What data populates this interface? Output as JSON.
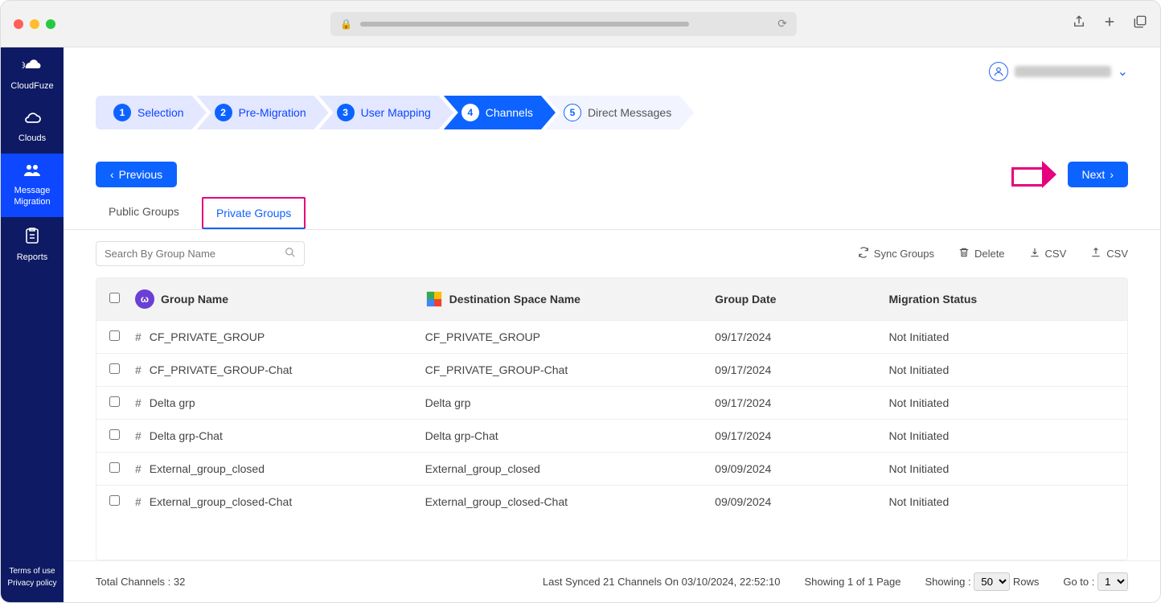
{
  "browser": {
    "share_icon": "share-icon",
    "plus_icon": "plus-icon",
    "tabs_icon": "tabs-icon"
  },
  "sidebar": {
    "items": [
      {
        "icon": "cloudfuze-logo",
        "label": "CloudFuze"
      },
      {
        "icon": "cloud-icon",
        "label": "Clouds"
      },
      {
        "icon": "people-icon",
        "label": "Message Migration"
      },
      {
        "icon": "report-icon",
        "label": "Reports"
      }
    ],
    "footer": {
      "terms": "Terms of use",
      "privacy": "Privacy policy"
    }
  },
  "header": {
    "user_name_blur": true
  },
  "stepper": [
    {
      "num": "1",
      "label": "Selection"
    },
    {
      "num": "2",
      "label": "Pre-Migration"
    },
    {
      "num": "3",
      "label": "User Mapping"
    },
    {
      "num": "4",
      "label": "Channels"
    },
    {
      "num": "5",
      "label": "Direct Messages"
    }
  ],
  "actions": {
    "previous": "Previous",
    "next": "Next"
  },
  "tabs": {
    "public": "Public Groups",
    "private": "Private Groups"
  },
  "search": {
    "placeholder": "Search By Group Name"
  },
  "toolbar": {
    "sync": "Sync Groups",
    "delete": "Delete",
    "csv_down": "CSV",
    "csv_up": "CSV"
  },
  "table": {
    "headers": {
      "group_name": "Group Name",
      "dest_space": "Destination Space Name",
      "group_date": "Group Date",
      "migration_status": "Migration Status"
    },
    "rows": [
      {
        "group": "CF_PRIVATE_GROUP",
        "dest": "CF_PRIVATE_GROUP",
        "date": "09/17/2024",
        "status": "Not Initiated"
      },
      {
        "group": "CF_PRIVATE_GROUP-Chat",
        "dest": "CF_PRIVATE_GROUP-Chat",
        "date": "09/17/2024",
        "status": "Not Initiated"
      },
      {
        "group": "Delta grp",
        "dest": "Delta grp",
        "date": "09/17/2024",
        "status": "Not Initiated"
      },
      {
        "group": "Delta grp-Chat",
        "dest": "Delta grp-Chat",
        "date": "09/17/2024",
        "status": "Not Initiated"
      },
      {
        "group": "External_group_closed",
        "dest": "External_group_closed",
        "date": "09/09/2024",
        "status": "Not Initiated"
      },
      {
        "group": "External_group_closed-Chat",
        "dest": "External_group_closed-Chat",
        "date": "09/09/2024",
        "status": "Not Initiated"
      }
    ]
  },
  "footer": {
    "total": "Total Channels : 32",
    "last_synced": "Last Synced 21 Channels On 03/10/2024, 22:52:10",
    "page_info": "Showing 1 of 1 Page",
    "showing_label": "Showing :",
    "rows_label": "Rows",
    "showing_value": "50",
    "goto_label": "Go to :",
    "goto_value": "1"
  }
}
